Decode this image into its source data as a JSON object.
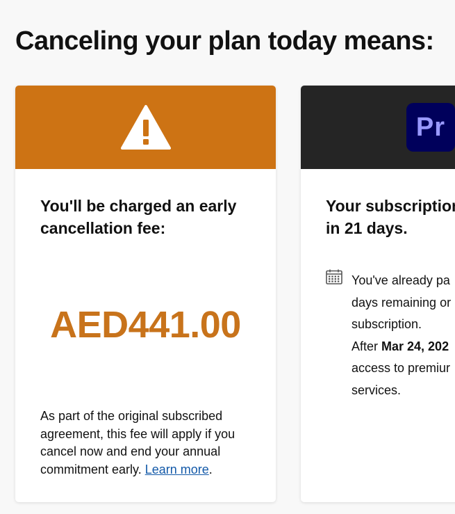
{
  "page": {
    "title": "Canceling your plan today means:"
  },
  "fee_card": {
    "icon": "warning-icon",
    "header_color": "#cd7314",
    "heading": "You'll be charged an early cancellation fee:",
    "amount": "AED441.00",
    "amount_color": "#c8731b",
    "note_text": "As part of the original subscribed agreement, this fee will apply if you cancel now and end your annual commitment early. ",
    "learn_more_label": "Learn more",
    "note_end": "."
  },
  "subscription_card": {
    "icon": "premiere-pro-icon",
    "icon_text": "Pr",
    "header_color": "#252525",
    "heading_line1": "Your subscription",
    "heading_line2": "in 21 days.",
    "info_icon": "calendar-icon",
    "info_line1": "You've already pa",
    "info_line2": "days remaining or",
    "info_line3": "subscription.",
    "info_line4_prefix": "After ",
    "info_line4_date": "Mar 24, 202",
    "info_line5": "access to premiur",
    "info_line6": "services."
  }
}
